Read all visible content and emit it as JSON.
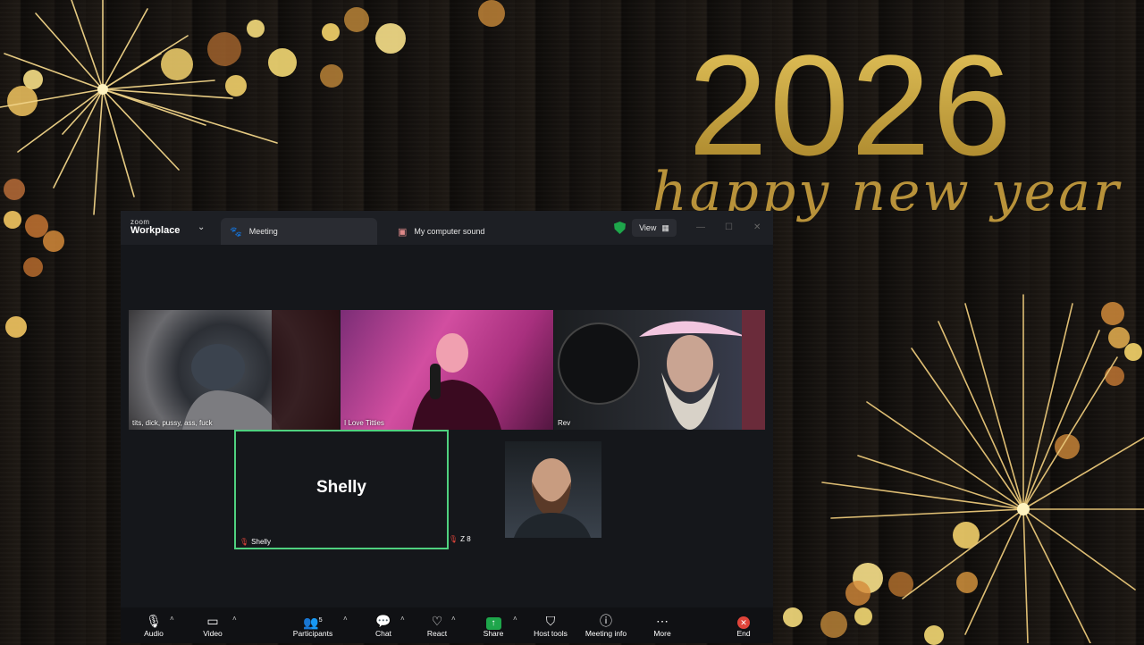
{
  "background": {
    "year": "2026",
    "greeting": "happy new year",
    "accent_gold": "#c9a233"
  },
  "window": {
    "brand_small": "zoom",
    "brand_big": "Workplace",
    "tabs": [
      {
        "label": "Meeting",
        "icon": "paw-icon"
      },
      {
        "label": "My computer sound",
        "icon": "speaker-icon"
      }
    ],
    "view_label": "View",
    "security_color": "#1ea64b"
  },
  "participants": {
    "tile1_name": "tits, dick, pussy, ass, fuck",
    "tile2_name": "I Love Titties",
    "tile3_name": "Rev",
    "active_name_big": "Shelly",
    "active_name_small": "Shelly",
    "tile5_name": "Z 8"
  },
  "toolbar": {
    "audio": "Audio",
    "video": "Video",
    "participants": "Participants",
    "participants_count": "5",
    "chat": "Chat",
    "react": "React",
    "share": "Share",
    "host_tools": "Host tools",
    "meeting_info": "Meeting info",
    "more": "More",
    "end": "End"
  }
}
